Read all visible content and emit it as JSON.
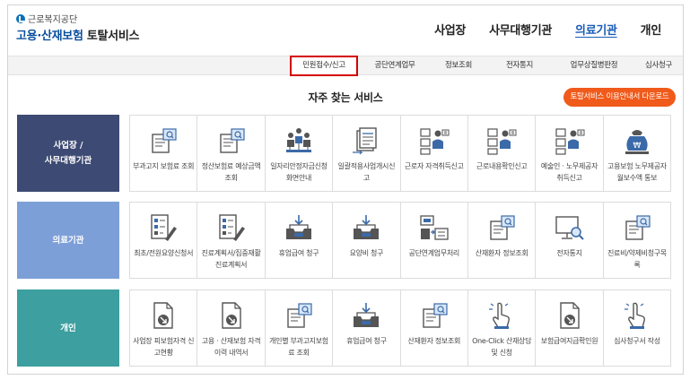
{
  "logo": {
    "org": "근로복지공단",
    "brand": "고용·산재보험",
    "service": "토탈서비스"
  },
  "topnav": [
    {
      "label": "사업장",
      "active": false
    },
    {
      "label": "사무대행기관",
      "active": false
    },
    {
      "label": "의료기관",
      "active": true
    },
    {
      "label": "개인",
      "active": false
    }
  ],
  "subnav": [
    {
      "label": "민원접수/신고",
      "selected": true
    },
    {
      "label": "공단연계업무",
      "selected": false
    },
    {
      "label": "정보조회",
      "selected": false
    },
    {
      "label": "전자통지",
      "selected": false
    },
    {
      "label": "업무상질병판정",
      "selected": false
    },
    {
      "label": "심사청구",
      "selected": false
    }
  ],
  "section_title": "자주 찾는 서비스",
  "guide_button": "토탈서비스 이용안내서 다운로드",
  "rows": [
    {
      "label_line1": "사업장 /",
      "label_line2": "사무대행기관",
      "items": [
        {
          "label": "부과고지 보험료 조회",
          "icon": "document-search-icon"
        },
        {
          "label": "정산보험료 예상금액 조회",
          "icon": "document-search-icon"
        },
        {
          "label": "일자리안정자금신청화면안내",
          "icon": "people-group-icon"
        },
        {
          "label": "일괄적용사업개시신고",
          "icon": "document-stack-icon"
        },
        {
          "label": "근로자 자격취득신고",
          "icon": "worker-list-icon"
        },
        {
          "label": "근로내용확인신고",
          "icon": "worker-list-icon"
        },
        {
          "label": "예술인 · 노무제공자 취득신고",
          "icon": "worker-list-icon"
        },
        {
          "label": "고용보험 노무제공자 월보수액 통보",
          "icon": "money-bag-icon"
        }
      ]
    },
    {
      "label_line1": "의료기관",
      "label_line2": "",
      "items": [
        {
          "label": "최초/전원요양신청서",
          "icon": "form-pen-icon"
        },
        {
          "label": "진료계획서/집중재활진료계획서",
          "icon": "form-pen-icon"
        },
        {
          "label": "휴업급여 청구",
          "icon": "inbox-tray-icon"
        },
        {
          "label": "요양비 청구",
          "icon": "inbox-tray-icon"
        },
        {
          "label": "공단연계업무처리",
          "icon": "exchange-icon"
        },
        {
          "label": "산재환자 정보조회",
          "icon": "document-search-icon"
        },
        {
          "label": "전자통지",
          "icon": "monitor-search-icon"
        },
        {
          "label": "진료비/약제비청구목록",
          "icon": "document-search-icon"
        }
      ]
    },
    {
      "label_line1": "개인",
      "label_line2": "",
      "items": [
        {
          "label": "사업장 피보험자격 신고현황",
          "icon": "document-arrow-icon"
        },
        {
          "label": "고용 · 산재보험 자격 이력 내역서",
          "icon": "document-arrow-icon"
        },
        {
          "label": "개인별 부과고지보험료 조회",
          "icon": "document-search-icon"
        },
        {
          "label": "휴업급여 청구",
          "icon": "inbox-tray-icon"
        },
        {
          "label": "산재환자 정보조회",
          "icon": "document-search-icon"
        },
        {
          "label": "One-Click 산재상담 및 신청",
          "icon": "hand-click-icon"
        },
        {
          "label": "보험급여지급확인원",
          "icon": "document-arrow-icon"
        },
        {
          "label": "심사청구서 작성",
          "icon": "hand-click-icon"
        }
      ]
    }
  ],
  "colors": {
    "accent": "#1a5db8",
    "orange": "#f05a1a",
    "row1": "#3d4a73",
    "row2": "#7d9fd8",
    "row3": "#3d9fa0",
    "highlight": "#d40000"
  }
}
